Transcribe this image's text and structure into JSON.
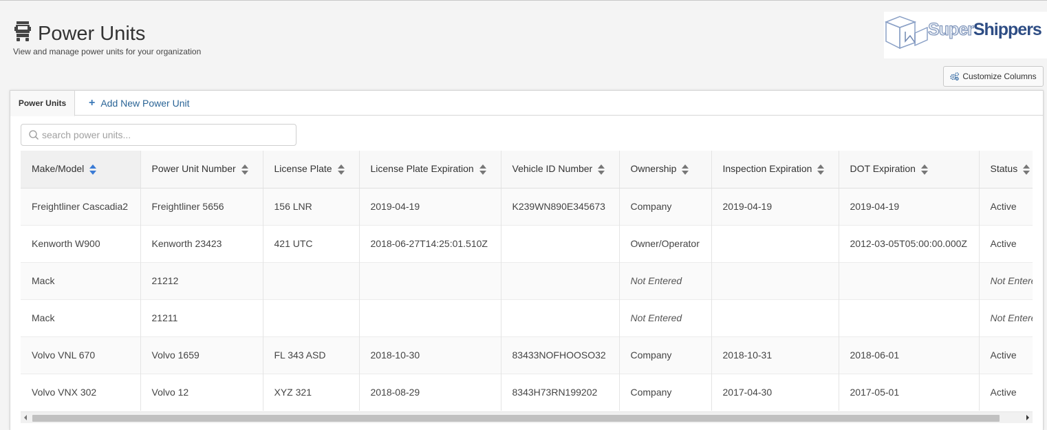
{
  "header": {
    "title": "Power Units",
    "subtitle": "View and manage power units for your organization",
    "icon": "truck-icon"
  },
  "logo": {
    "part1": "Super",
    "part2": "Shippers"
  },
  "toolbar": {
    "customize_columns_label": "Customize Columns",
    "customize_icon": "gears-icon"
  },
  "tabs": {
    "active_label": "Power Units",
    "add_label": "Add New Power Unit"
  },
  "search": {
    "placeholder": "search power units...",
    "value": ""
  },
  "table": {
    "columns": [
      "Make/Model",
      "Power Unit Number",
      "License Plate",
      "License Plate Expiration",
      "Vehicle ID Number",
      "Ownership",
      "Inspection Expiration",
      "DOT Expiration",
      "Status"
    ],
    "sorted_column": "Make/Model",
    "rows": [
      [
        "Freightliner Cascadia2",
        "Freightliner 5656",
        "156 LNR",
        "2019-04-19",
        "K239WN890E345673",
        "Company",
        "2019-04-19",
        "2019-04-19",
        "Active"
      ],
      [
        "Kenworth W900",
        "Kenworth 23423",
        "421 UTC",
        "2018-06-27T14:25:01.510Z",
        "",
        "Owner/Operator",
        "",
        "2012-03-05T05:00:00.000Z",
        "Active"
      ],
      [
        "Mack",
        "21212",
        "",
        "",
        "",
        "Not Entered",
        "",
        "",
        "Not Entered"
      ],
      [
        "Mack",
        "21211",
        "",
        "",
        "",
        "Not Entered",
        "",
        "",
        "Not Entered"
      ],
      [
        "Volvo VNL 670",
        "Volvo 1659",
        "FL 343 ASD",
        "2018-10-30",
        "83433NOFHOOSO32",
        "Company",
        "2018-10-31",
        "2018-06-01",
        "Active"
      ],
      [
        "Volvo VNX 302",
        "Volvo 12",
        "XYZ 321",
        "2018-08-29",
        "8343H73RN199202",
        "Company",
        "2017-04-30",
        "2017-05-01",
        "Active"
      ]
    ]
  },
  "colors": {
    "link": "#2a6496",
    "sort_active": "#3a7bd5",
    "sort_inactive": "#777777"
  }
}
